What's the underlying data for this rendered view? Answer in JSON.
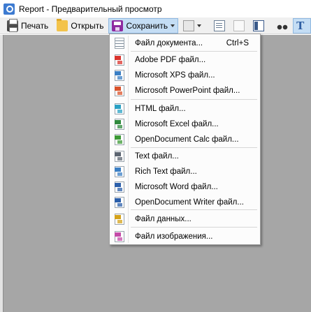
{
  "window": {
    "title": "Report - Предварительный просмотр"
  },
  "toolbar": {
    "print_label": "Печать",
    "open_label": "Открыть",
    "save_label": "Сохранить"
  },
  "save_menu": {
    "items": [
      {
        "label": "Файл документа...",
        "shortcut": "Ctrl+S",
        "icon": "document-file-icon",
        "tag": "",
        "color": "#7a8a99"
      },
      {
        "label": "Adobe PDF файл...",
        "icon": "pdf-file-icon",
        "tag": "PDF",
        "color": "#d9322b"
      },
      {
        "label": "Microsoft XPS файл...",
        "icon": "xps-file-icon",
        "tag": "XPS",
        "color": "#3b7fc4"
      },
      {
        "label": "Microsoft PowerPoint файл...",
        "icon": "pptx-file-icon",
        "tag": "PPT",
        "color": "#d9532b"
      },
      {
        "label": "HTML файл...",
        "icon": "html-file-icon",
        "tag": "HTM",
        "color": "#2aa1c4"
      },
      {
        "label": "Microsoft Excel файл...",
        "icon": "xlsx-file-icon",
        "tag": "XLS",
        "color": "#2f8a3d"
      },
      {
        "label": "OpenDocument Calc файл...",
        "icon": "ods-file-icon",
        "tag": "ODS",
        "color": "#3c9a36"
      },
      {
        "label": "Text файл...",
        "icon": "txt-file-icon",
        "tag": "TXT",
        "color": "#5b6470"
      },
      {
        "label": "Rich Text файл...",
        "icon": "rtf-file-icon",
        "tag": "RTF",
        "color": "#3b7fc4"
      },
      {
        "label": "Microsoft Word файл...",
        "icon": "docx-file-icon",
        "tag": "DOC",
        "color": "#2b5faa"
      },
      {
        "label": "OpenDocument Writer файл...",
        "icon": "odt-file-icon",
        "tag": "ODT",
        "color": "#2b5faa"
      },
      {
        "label": "Файл данных...",
        "icon": "data-file-icon",
        "tag": "DAT",
        "color": "#d4a21a"
      },
      {
        "label": "Файл изображения...",
        "icon": "image-file-icon",
        "tag": "IMG",
        "color": "#c44ba8"
      }
    ]
  },
  "colors": {
    "accent_selected": "#c4ddf4",
    "workspace": "#a6a6a6"
  }
}
